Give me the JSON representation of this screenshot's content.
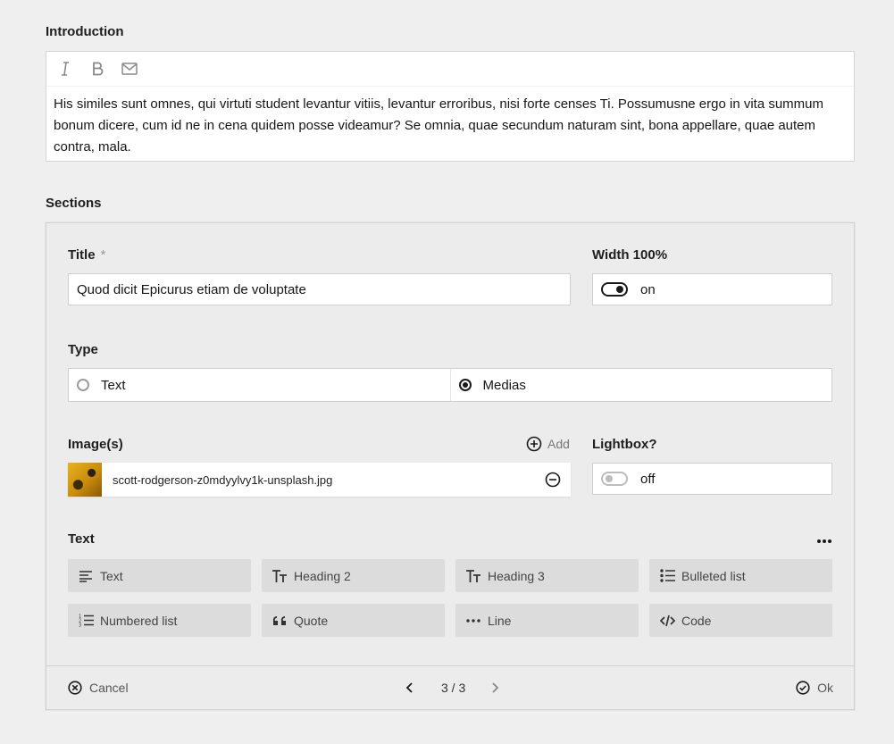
{
  "introduction": {
    "label": "Introduction",
    "toolbar": {
      "italic_icon": "italic-icon",
      "bold_icon": "bold-icon",
      "email_icon": "email-icon"
    },
    "text": "His similes sunt omnes, qui virtuti student levantur vitiis, levantur erroribus, nisi forte censes Ti. Possumusne ergo in vita summum bonum dicere, cum id ne in cena quidem posse videamur? Se omnia, quae secundum naturam sint, bona appellare, quae autem contra, mala."
  },
  "sections": {
    "label": "Sections",
    "title_field": {
      "label": "Title",
      "required_marker": "*",
      "value": "Quod dicit Epicurus etiam de voluptate"
    },
    "width_field": {
      "label": "Width 100%",
      "state": "on"
    },
    "type_field": {
      "label": "Type",
      "options": [
        "Text",
        "Medias"
      ],
      "selected": "Medias"
    },
    "images_field": {
      "label": "Image(s)",
      "add_label": "Add",
      "files": [
        "scott-rodgerson-z0mdyylvy1k-unsplash.jpg"
      ]
    },
    "lightbox_field": {
      "label": "Lightbox?",
      "state": "off"
    },
    "text_field": {
      "label": "Text",
      "blocks": [
        "Text",
        "Heading 2",
        "Heading 3",
        "Bulleted list",
        "Numbered list",
        "Quote",
        "Line",
        "Code"
      ]
    },
    "footer": {
      "cancel_label": "Cancel",
      "pagination": "3 / 3",
      "ok_label": "Ok"
    }
  },
  "colors": {
    "background": "#efefef",
    "panel": "#ececec",
    "block_button": "#dcdcdc",
    "text": "#161616"
  }
}
